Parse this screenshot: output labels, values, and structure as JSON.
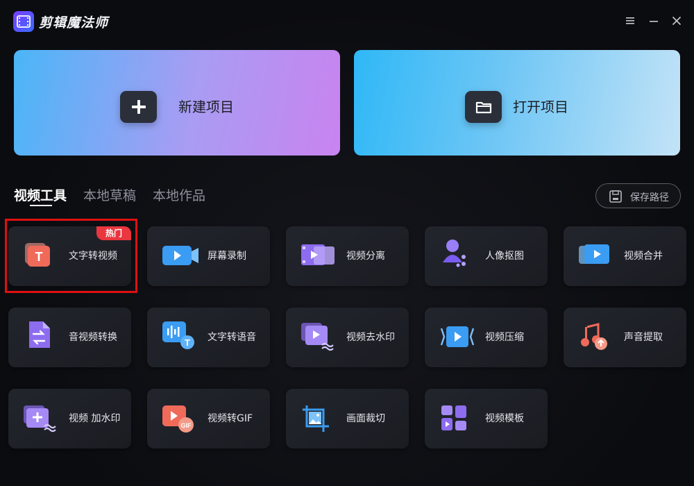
{
  "app": {
    "title": "剪辑魔法师"
  },
  "projects": {
    "new_label": "新建项目",
    "open_label": "打开项目"
  },
  "tabs": [
    {
      "label": "视频工具",
      "active": true
    },
    {
      "label": "本地草稿",
      "active": false
    },
    {
      "label": "本地作品",
      "active": false
    }
  ],
  "save_path": {
    "label": "保存路径"
  },
  "tools": [
    {
      "label": "文字转视频",
      "icon": "text-to-video-icon",
      "badge": "热门"
    },
    {
      "label": "屏幕录制",
      "icon": "screen-record-icon"
    },
    {
      "label": "视频分离",
      "icon": "video-split-icon"
    },
    {
      "label": "人像抠图",
      "icon": "portrait-cutout-icon"
    },
    {
      "label": "视频合并",
      "icon": "video-merge-icon"
    },
    {
      "label": "音视频转换",
      "icon": "av-convert-icon"
    },
    {
      "label": "文字转语音",
      "icon": "text-to-speech-icon"
    },
    {
      "label": "视频去水印",
      "icon": "remove-watermark-icon"
    },
    {
      "label": "视频压缩",
      "icon": "video-compress-icon"
    },
    {
      "label": "声音提取",
      "icon": "audio-extract-icon"
    },
    {
      "label": "视频 加水印",
      "icon": "add-watermark-icon"
    },
    {
      "label": "视频转GIF",
      "icon": "video-to-gif-icon"
    },
    {
      "label": "画面裁切",
      "icon": "crop-icon"
    },
    {
      "label": "视频模板",
      "icon": "video-template-icon"
    }
  ],
  "colors": {
    "hot_badge": "#e9363f",
    "highlight_border": "#e01010",
    "accent_purple": "#7b3cff"
  }
}
